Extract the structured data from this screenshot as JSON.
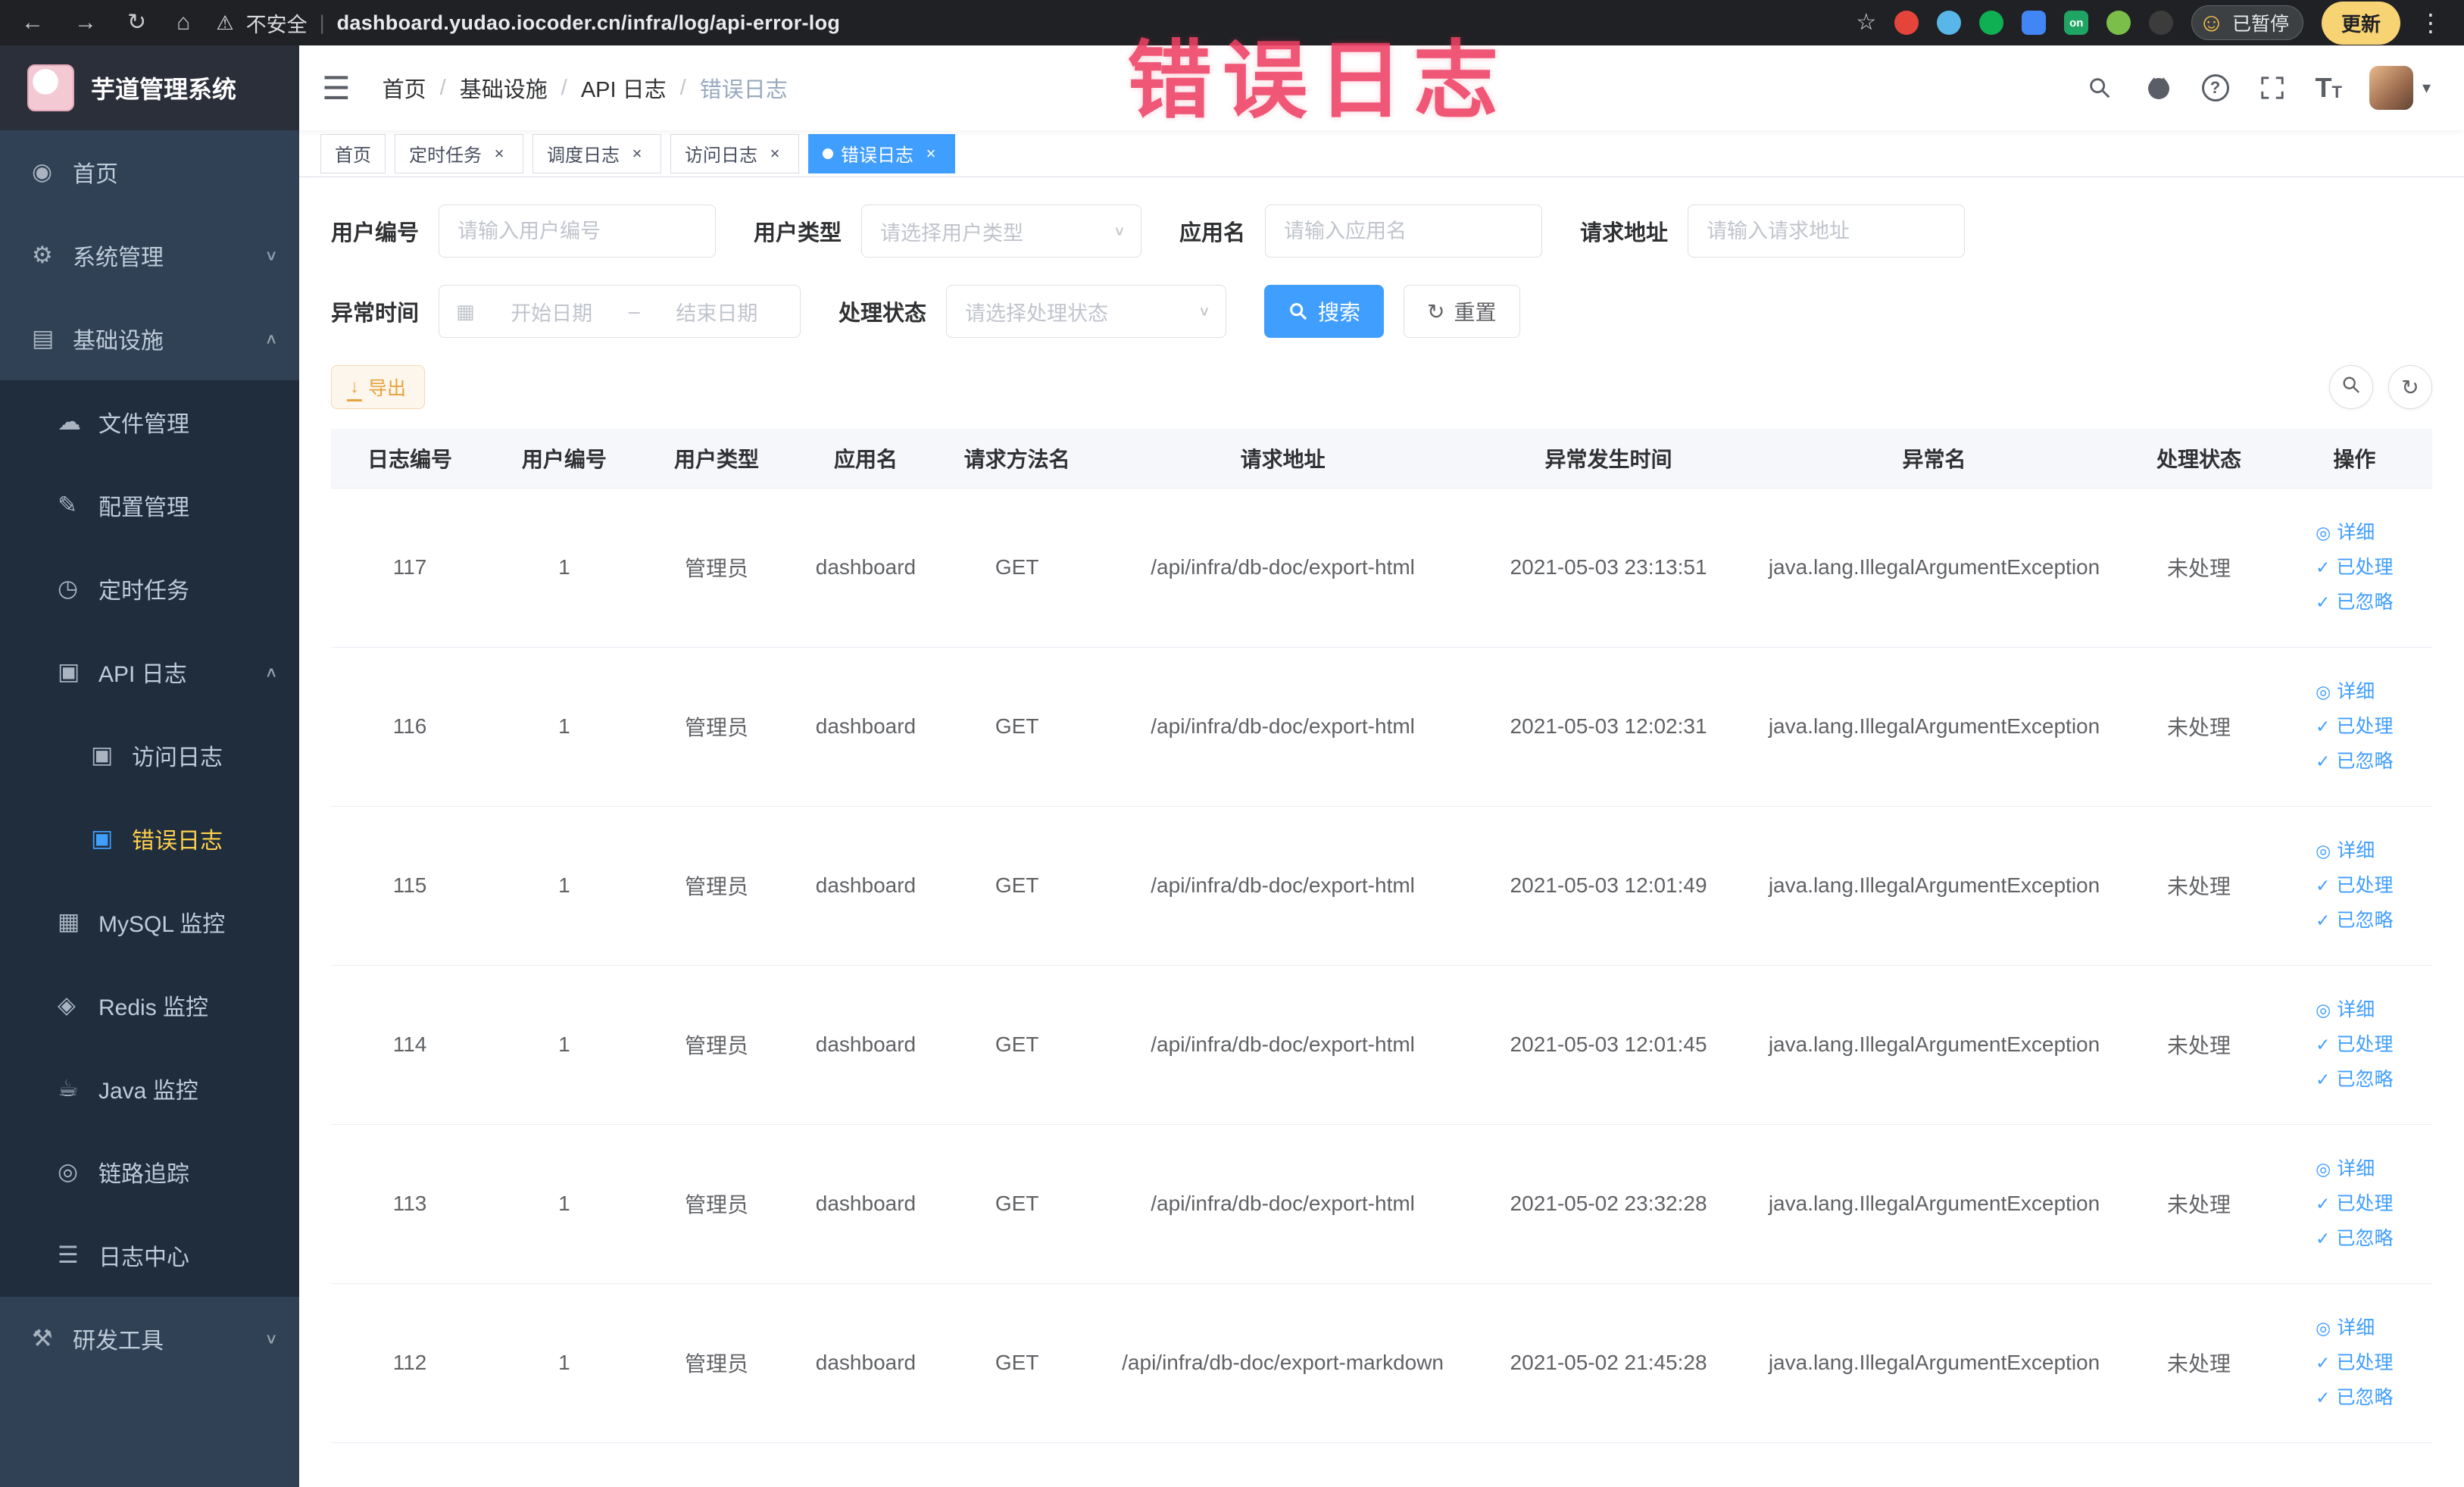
{
  "colors": {
    "accent": "#409eff",
    "sidebar_bg": "#304156",
    "sidebar_sub_bg": "#1f2d3d",
    "active_menu_text": "#ffd04b",
    "annotation": "#ee3f63",
    "warning": "#e6a23c"
  },
  "icons": {
    "back": "←",
    "forward": "→",
    "reload": "↻",
    "home": "⌂",
    "warning": "⚠",
    "pipe": "|",
    "star": "☆",
    "more": "⋮",
    "smiley": "☺",
    "menu": "☰",
    "slash": "/",
    "chevron_down": "∨",
    "chevron_up": "∧",
    "caret_down": "▾",
    "close": "×",
    "question": "?",
    "font_T": "T",
    "calendar": "▦",
    "refresh": "↻",
    "download": "↓",
    "eye": "◎",
    "check": "✓"
  },
  "browser": {
    "security": "不安全",
    "url": "dashboard.yudao.iocoder.cn/infra/log/api-error-log",
    "ext_on": "on",
    "paused": "已暂停",
    "update": "更新"
  },
  "annotation": {
    "text": "错误日志"
  },
  "sidebar": {
    "logo_title": "芋道管理系统",
    "items": [
      {
        "icon": "◉",
        "label": "首页"
      },
      {
        "icon": "⚙",
        "label": "系统管理"
      },
      {
        "icon": "▤",
        "label": "基础设施"
      },
      {
        "icon": "☁",
        "label": "文件管理"
      },
      {
        "icon": "✎",
        "label": "配置管理"
      },
      {
        "icon": "◷",
        "label": "定时任务"
      },
      {
        "icon": "▣",
        "label": "API 日志"
      },
      {
        "icon": "▣",
        "label": "访问日志"
      },
      {
        "icon": "▣",
        "label": "错误日志"
      },
      {
        "icon": "▦",
        "label": "MySQL 监控"
      },
      {
        "icon": "◈",
        "label": "Redis 监控"
      },
      {
        "icon": "☕",
        "label": "Java 监控"
      },
      {
        "icon": "◎",
        "label": "链路追踪"
      },
      {
        "icon": "☰",
        "label": "日志中心"
      },
      {
        "icon": "⚒",
        "label": "研发工具"
      }
    ]
  },
  "breadcrumb": [
    "首页",
    "基础设施",
    "API 日志",
    "错误日志"
  ],
  "tabs": [
    {
      "label": "首页"
    },
    {
      "label": "定时任务"
    },
    {
      "label": "调度日志"
    },
    {
      "label": "访问日志"
    },
    {
      "label": "错误日志"
    }
  ],
  "filters": {
    "user_id": {
      "label": "用户编号",
      "placeholder": "请输入用户编号"
    },
    "user_type": {
      "label": "用户类型",
      "placeholder": "请选择用户类型"
    },
    "app_name": {
      "label": "应用名",
      "placeholder": "请输入应用名"
    },
    "request_url": {
      "label": "请求地址",
      "placeholder": "请输入请求地址"
    },
    "exception_time": {
      "label": "异常时间",
      "start_placeholder": "开始日期",
      "separator": "–",
      "end_placeholder": "结束日期"
    },
    "process_status": {
      "label": "处理状态",
      "placeholder": "请选择处理状态"
    },
    "search_label": "搜索",
    "reset_label": "重置"
  },
  "toolbar": {
    "export_label": "导出"
  },
  "table": {
    "columns": [
      "日志编号",
      "用户编号",
      "用户类型",
      "应用名",
      "请求方法名",
      "请求地址",
      "异常发生时间",
      "异常名",
      "处理状态",
      "操作"
    ],
    "actions": [
      "详细",
      "已处理",
      "已忽略"
    ],
    "rows": [
      {
        "id": "117",
        "user_id": "1",
        "user_type": "管理员",
        "app": "dashboard",
        "method": "GET",
        "url": "/api/infra/db-doc/export-html",
        "time": "2021-05-03 23:13:51",
        "exception": "java.lang.IllegalArgumentException",
        "status": "未处理"
      },
      {
        "id": "116",
        "user_id": "1",
        "user_type": "管理员",
        "app": "dashboard",
        "method": "GET",
        "url": "/api/infra/db-doc/export-html",
        "time": "2021-05-03 12:02:31",
        "exception": "java.lang.IllegalArgumentException",
        "status": "未处理"
      },
      {
        "id": "115",
        "user_id": "1",
        "user_type": "管理员",
        "app": "dashboard",
        "method": "GET",
        "url": "/api/infra/db-doc/export-html",
        "time": "2021-05-03 12:01:49",
        "exception": "java.lang.IllegalArgumentException",
        "status": "未处理"
      },
      {
        "id": "114",
        "user_id": "1",
        "user_type": "管理员",
        "app": "dashboard",
        "method": "GET",
        "url": "/api/infra/db-doc/export-html",
        "time": "2021-05-03 12:01:45",
        "exception": "java.lang.IllegalArgumentException",
        "status": "未处理"
      },
      {
        "id": "113",
        "user_id": "1",
        "user_type": "管理员",
        "app": "dashboard",
        "method": "GET",
        "url": "/api/infra/db-doc/export-html",
        "time": "2021-05-02 23:32:28",
        "exception": "java.lang.IllegalArgumentException",
        "status": "未处理"
      },
      {
        "id": "112",
        "user_id": "1",
        "user_type": "管理员",
        "app": "dashboard",
        "method": "GET",
        "url": "/api/infra/db-doc/export-markdown",
        "time": "2021-05-02 21:45:28",
        "exception": "java.lang.IllegalArgumentException",
        "status": "未处理"
      }
    ]
  }
}
